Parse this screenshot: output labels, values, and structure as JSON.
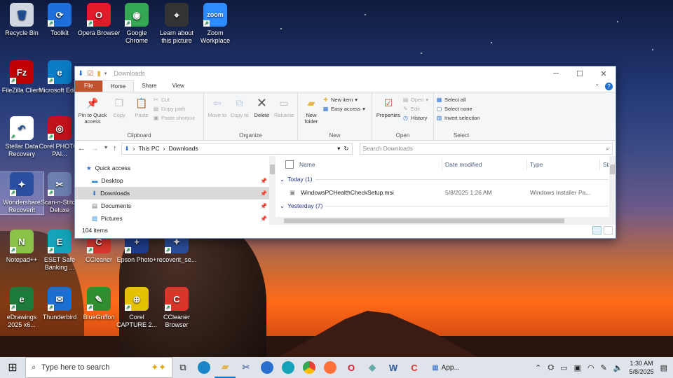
{
  "desktop_icons": [
    {
      "label": "Recycle Bin",
      "color": "#cfd8e0",
      "glyph": "🗑"
    },
    {
      "label": "Toolkit",
      "color": "#1e6fd9",
      "glyph": "⟳"
    },
    {
      "label": "Opera Browser",
      "color": "#e21b2b",
      "glyph": "O"
    },
    {
      "label": "Google Chrome",
      "color": "#34a853",
      "glyph": "◉"
    },
    {
      "label": "Learn about this picture",
      "color": "#333333",
      "glyph": "⌖"
    },
    {
      "label": "Zoom Workplace",
      "color": "#2d8cff",
      "glyph": "zoom"
    },
    {
      "label": "FileZilla Client",
      "color": "#bf0000",
      "glyph": "Fz"
    },
    {
      "label": "Microsoft Edge",
      "color": "#0a7bc4",
      "glyph": "e"
    },
    {
      "label": "Stellar Data Recovery",
      "color": "#ffffff",
      "glyph": "↶"
    },
    {
      "label": "Corel PHOTO-PAI...",
      "color": "#c2121b",
      "glyph": "◎"
    },
    {
      "label": "Wondershare Recoverit",
      "color": "#2a4fa0",
      "glyph": "✦"
    },
    {
      "label": "Scan-n-Stitch Deluxe",
      "color": "#6b7fb0",
      "glyph": "✂"
    },
    {
      "label": "Notepad++",
      "color": "#8bc34a",
      "glyph": "N"
    },
    {
      "label": "ESET Safe Banking ...",
      "color": "#14a3b8",
      "glyph": "E"
    },
    {
      "label": "CCleaner",
      "color": "#d9362b",
      "glyph": "C"
    },
    {
      "label": "Epson Photo+",
      "color": "#1e3c8c",
      "glyph": "+"
    },
    {
      "label": "recoverit_se...",
      "color": "#2b4e9c",
      "glyph": "✦"
    },
    {
      "label": "eDrawings 2025 x6...",
      "color": "#1c7a3a",
      "glyph": "e"
    },
    {
      "label": "Thunderbird",
      "color": "#1a6fd1",
      "glyph": "✉"
    },
    {
      "label": "BlueGriffon",
      "color": "#2f8f2f",
      "glyph": "✎"
    },
    {
      "label": "Corel CAPTURE 2...",
      "color": "#e3c200",
      "glyph": "⊕"
    },
    {
      "label": "CCleaner Browser",
      "color": "#d9362b",
      "glyph": "C"
    }
  ],
  "window": {
    "title": "Downloads",
    "tabs": {
      "file": "File",
      "home": "Home",
      "share": "Share",
      "view": "View"
    },
    "ribbon": {
      "clipboard": {
        "name": "Clipboard",
        "pin": "Pin to Quick access",
        "copy": "Copy",
        "paste": "Paste",
        "cut": "Cut",
        "copy_path": "Copy path",
        "paste_shortcut": "Paste shortcut"
      },
      "organize": {
        "name": "Organize",
        "move_to": "Move to",
        "copy_to": "Copy to",
        "delete": "Delete",
        "rename": "Rename"
      },
      "new": {
        "name": "New",
        "new_folder": "New folder",
        "new_item": "New item",
        "easy_access": "Easy access"
      },
      "open": {
        "name": "Open",
        "properties": "Properties",
        "open": "Open",
        "edit": "Edit",
        "history": "History"
      },
      "select": {
        "name": "Select",
        "select_all": "Select all",
        "select_none": "Select none",
        "invert": "Invert selection"
      }
    },
    "address": {
      "this_pc": "This PC",
      "folder": "Downloads",
      "search_placeholder": "Search Downloads"
    },
    "nav_pane": [
      {
        "label": "Quick access",
        "icon": "star-icon",
        "pinned": false
      },
      {
        "label": "Desktop",
        "icon": "desktop-icon",
        "pinned": true
      },
      {
        "label": "Downloads",
        "icon": "download-icon",
        "pinned": true
      },
      {
        "label": "Documents",
        "icon": "document-icon",
        "pinned": true
      },
      {
        "label": "Pictures",
        "icon": "picture-icon",
        "pinned": true
      }
    ],
    "columns": {
      "name": "Name",
      "date": "Date modified",
      "type": "Type",
      "size": "Size"
    },
    "groups": {
      "today": "Today (1)",
      "yesterday": "Yesterday (7)"
    },
    "files": [
      {
        "name": "WindowsPCHealthCheckSetup.msi",
        "date": "5/8/2025 1:26 AM",
        "type": "Windows Installer Pa..."
      }
    ],
    "status": "104 items"
  },
  "taskbar": {
    "search_placeholder": "Type here to search",
    "app_label": "App...",
    "time": "1:30 AM",
    "date": "5/8/2025"
  },
  "colors": {
    "accent": "#0078d7",
    "file_tab": "#c2512d"
  }
}
